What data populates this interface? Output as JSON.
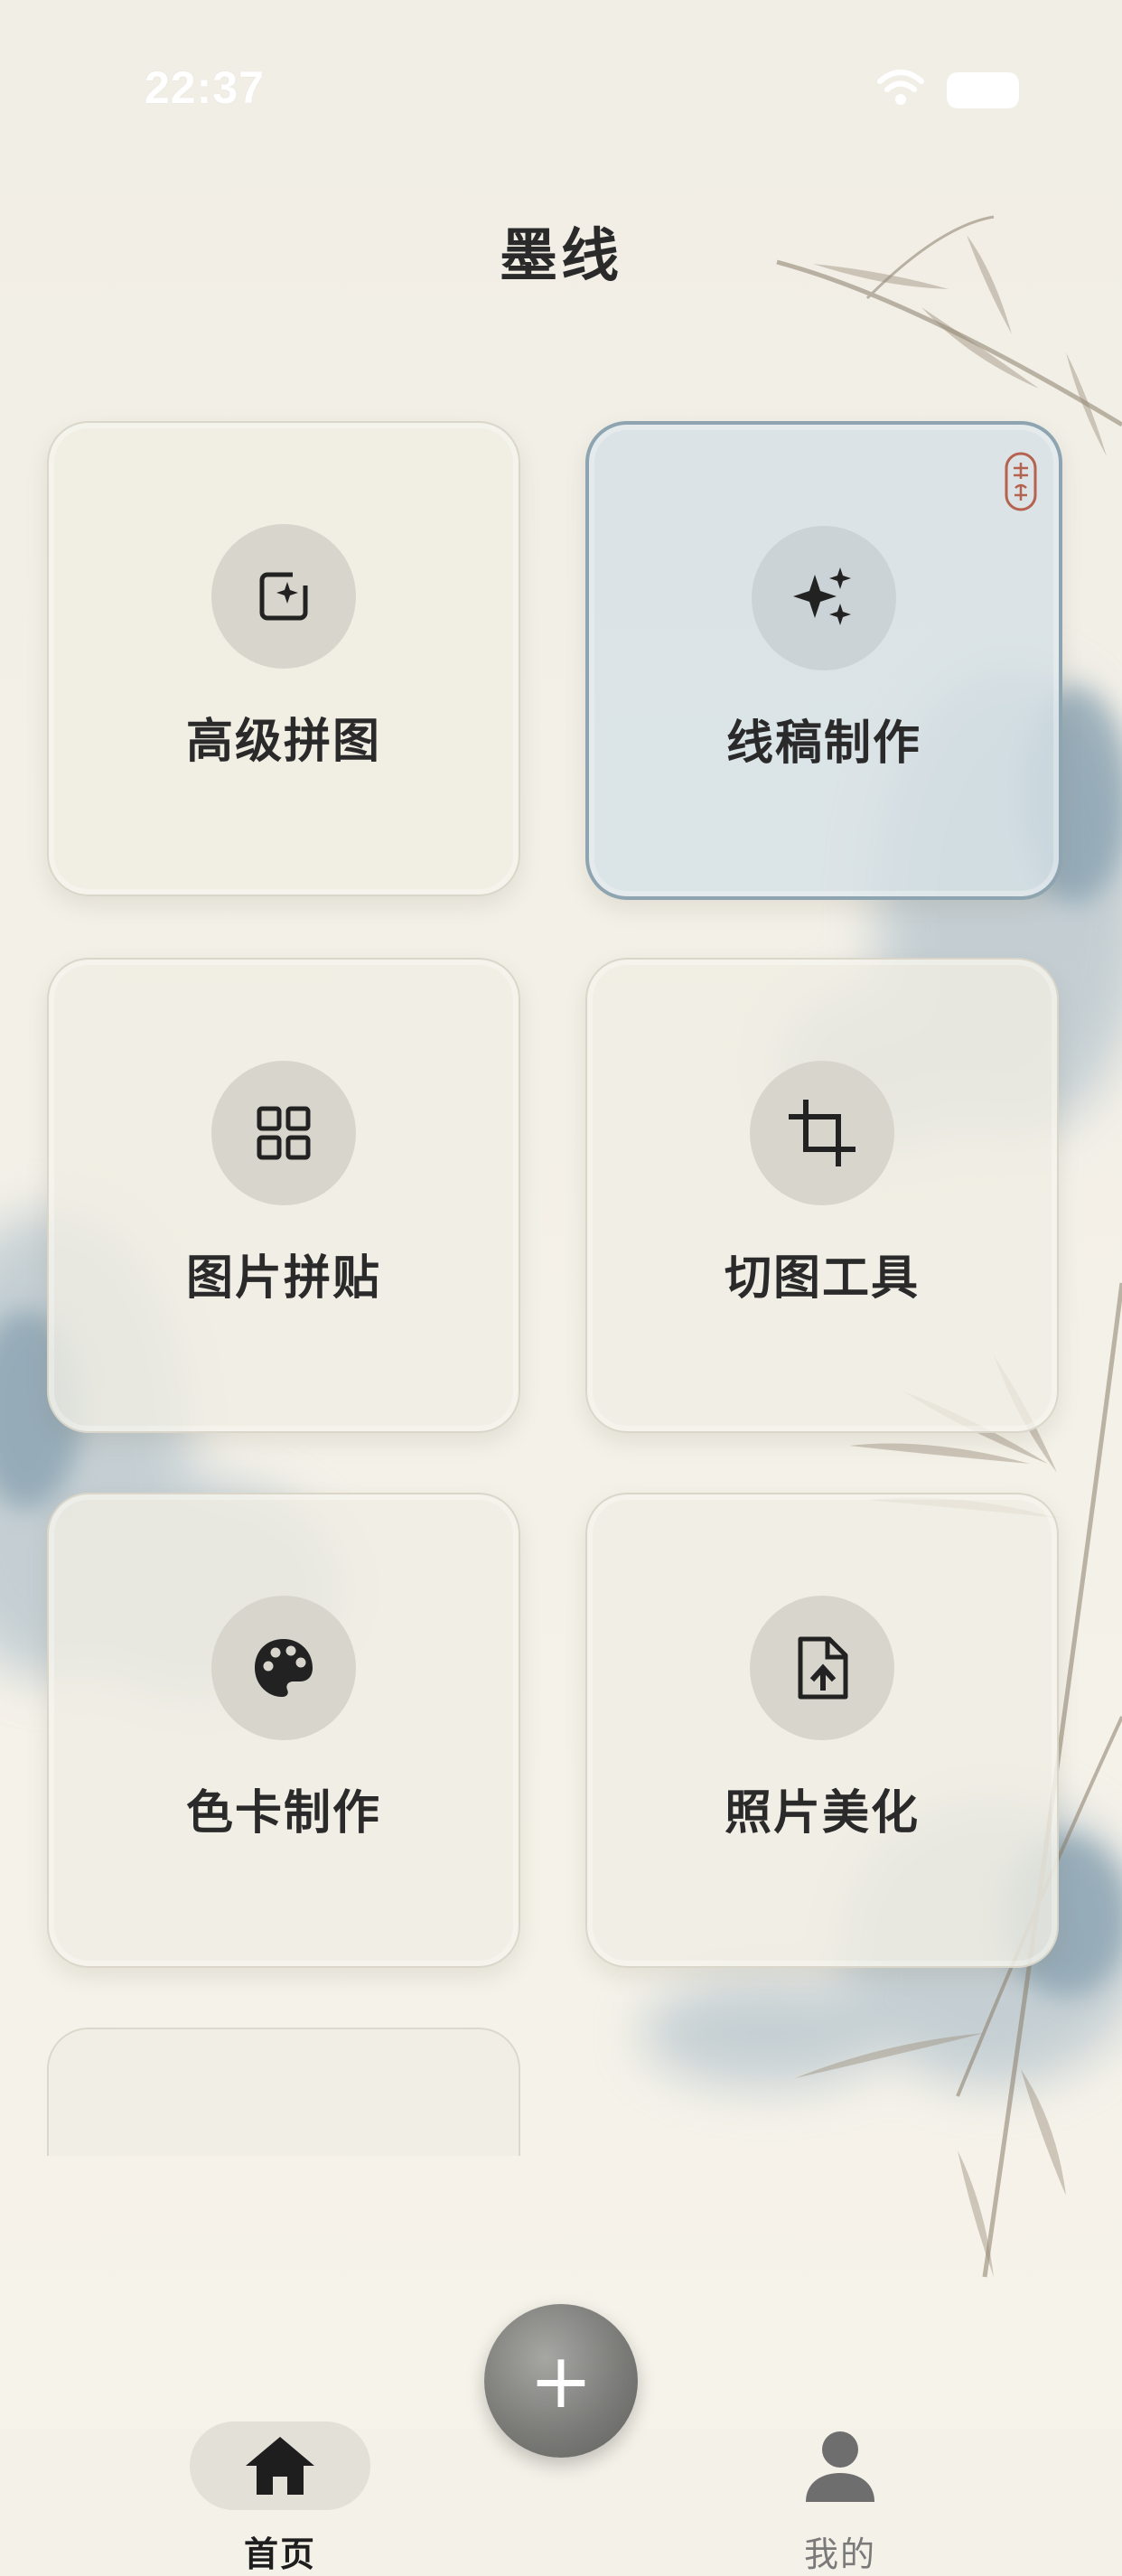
{
  "status_bar": {
    "time": "22:37"
  },
  "app": {
    "title": "墨线"
  },
  "tools": [
    {
      "label": "高级拼图",
      "icon": "image-sparkle-icon",
      "active": false
    },
    {
      "label": "线稿制作",
      "icon": "sparkles-icon",
      "active": true
    },
    {
      "label": "图片拼贴",
      "icon": "grid-icon",
      "active": false
    },
    {
      "label": "切图工具",
      "icon": "crop-icon",
      "active": false
    },
    {
      "label": "色卡制作",
      "icon": "palette-icon",
      "active": false
    },
    {
      "label": "照片美化",
      "icon": "file-upload-icon",
      "active": false
    }
  ],
  "tabbar": {
    "fab_symbol": "+",
    "tabs": [
      {
        "label": "首页",
        "icon": "home-icon",
        "selected": true
      },
      {
        "label": "我的",
        "icon": "person-icon",
        "selected": false
      }
    ]
  },
  "colors": {
    "paper": "#f4f1e8",
    "card": "#f0ede4",
    "active_card": "#d6e0e5",
    "active_border": "#8ea4b1",
    "text": "#2a2a2a",
    "seal": "#b5624f"
  }
}
